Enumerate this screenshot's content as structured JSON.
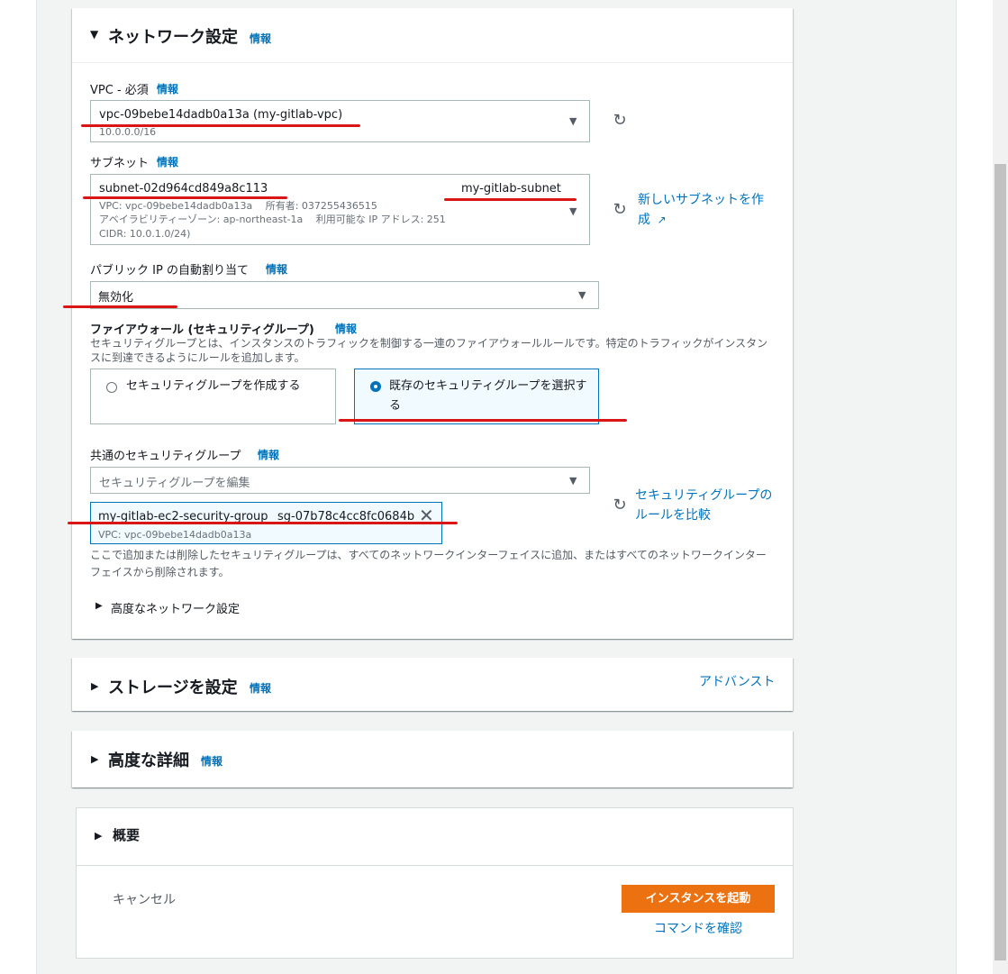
{
  "network": {
    "title": "ネットワーク設定",
    "info": "情報",
    "vpc": {
      "label": "VPC - 必須",
      "info": "情報",
      "value": "vpc-09bebe14dadb0a13a (my-gitlab-vpc)",
      "cidr": "10.0.0.0/16"
    },
    "subnet": {
      "label": "サブネット",
      "info": "情報",
      "value": "subnet-02d964cd849a8c113",
      "name": "my-gitlab-subnet",
      "line1": "VPC: vpc-09bebe14dadb0a13a　 所有者: 037255436515",
      "line2": "アベイラビリティーゾーン: ap-northeast-1a　 利用可能な IP アドレス: 251",
      "line3": "CIDR: 10.0.1.0/24)",
      "new_link": "新しいサブネットを作成"
    },
    "public_ip": {
      "label": "パブリック IP の自動割り当て",
      "info": "情報",
      "value": "無効化"
    },
    "firewall": {
      "label": "ファイアウォール (セキュリティグループ)",
      "info": "情報",
      "description": "セキュリティグループとは、インスタンスのトラフィックを制御する一連のファイアウォールルールです。特定のトラフィックがインスタンスに到達できるようにルールを追加します。",
      "option_create": "セキュリティグループを作成する",
      "option_existing": "既存のセキュリティグループを選択する"
    },
    "common_sg": {
      "label": "共通のセキュリティグループ",
      "info": "情報",
      "placeholder": "セキュリティグループを編集",
      "token_name": "my-gitlab-ec2-security-group",
      "token_id": "sg-07b78c4cc8fc0684b",
      "token_vpc": "VPC: vpc-09bebe14dadb0a13a",
      "compare_link": "セキュリティグループのルールを比較",
      "note": "ここで追加または削除したセキュリティグループは、すべてのネットワークインターフェイスに追加、またはすべてのネットワークインターフェイスから削除されます。"
    },
    "advanced": "高度なネットワーク設定"
  },
  "storage": {
    "title": "ストレージを設定",
    "info": "情報",
    "advanced": "アドバンスト"
  },
  "details": {
    "title": "高度な詳細",
    "info": "情報"
  },
  "summary": {
    "title": "概要",
    "cancel": "キャンセル",
    "launch": "インスタンスを起動",
    "command": "コマンドを確認"
  },
  "colors": {
    "link": "#0073bb",
    "primary": "#ec7211",
    "annotation": "#d91515"
  }
}
